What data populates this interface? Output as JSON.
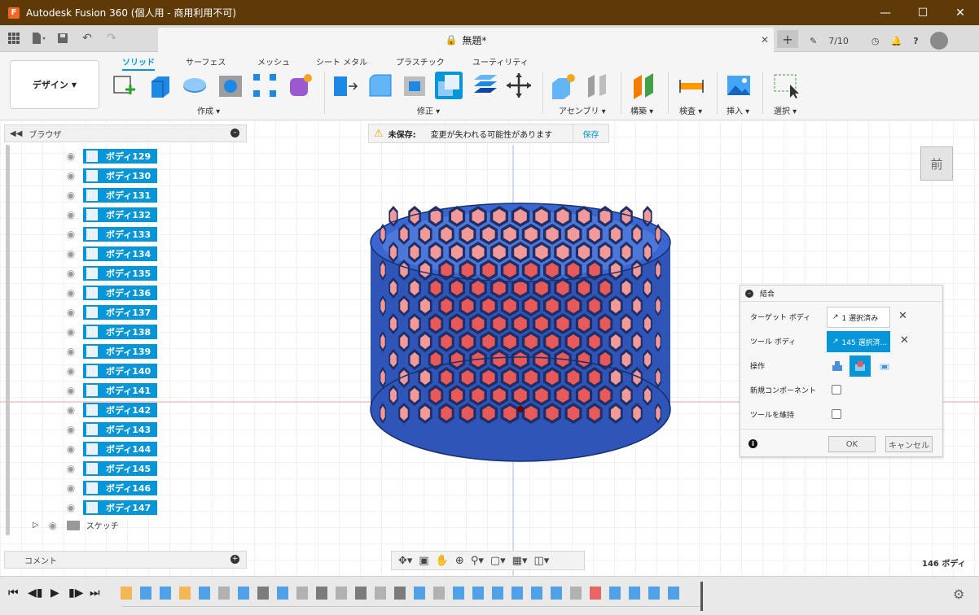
{
  "app": {
    "title": "Autodesk Fusion 360 (個人用 - 商用利用不可)",
    "icon_letter": "F",
    "window_buttons": [
      "minimize",
      "maximize",
      "close"
    ]
  },
  "tabbar": {
    "document_name": "無題*",
    "jobs_count": "7/10",
    "icons": [
      "grid-icon",
      "file-icon",
      "save-icon",
      "undo-icon",
      "redo-icon",
      "lock-icon",
      "close-icon",
      "plus-icon",
      "jobs-icon",
      "clock-icon",
      "bell-icon",
      "help-icon",
      "avatar"
    ]
  },
  "toolbar": {
    "workspace": "デザイン",
    "tabs": [
      "ソリッド",
      "サーフェス",
      "メッシュ",
      "シート メタル",
      "プラスチック",
      "ユーティリティ"
    ],
    "active_tab": "ソリッド",
    "groups": [
      "作成",
      "修正",
      "アセンブリ",
      "構築",
      "検査",
      "挿入",
      "選択"
    ]
  },
  "browser": {
    "title": "ブラウザ",
    "bodies": [
      "ボディ129",
      "ボディ130",
      "ボディ131",
      "ボディ132",
      "ボディ133",
      "ボディ134",
      "ボディ135",
      "ボディ136",
      "ボディ137",
      "ボディ138",
      "ボディ139",
      "ボディ140",
      "ボディ141",
      "ボディ142",
      "ボディ143",
      "ボディ144",
      "ボディ145",
      "ボディ146",
      "ボディ147"
    ],
    "sketch_folder": "スケッチ"
  },
  "comments": {
    "title": "コメント"
  },
  "unsaved": {
    "label": "未保存:",
    "message": "変更が失われる可能性があります",
    "save_button": "保存"
  },
  "viewcube": {
    "face": "前"
  },
  "combine_dialog": {
    "title": "結合",
    "target_label": "ターゲット ボディ",
    "target_value": "1 選択済み",
    "tool_label": "ツール ボディ",
    "tool_value": "145 選択済...",
    "operation_label": "操作",
    "new_component_label": "新規コンポーネント",
    "keep_tools_label": "ツールを維持",
    "ok": "OK",
    "cancel": "キャンセル"
  },
  "status": {
    "body_count": "146 ボディ"
  },
  "colors": {
    "title_bar": "#5d3a07",
    "accent": "#0696d7",
    "model_blue": "#2f55b8",
    "model_hex_red": "#e85a5a"
  }
}
